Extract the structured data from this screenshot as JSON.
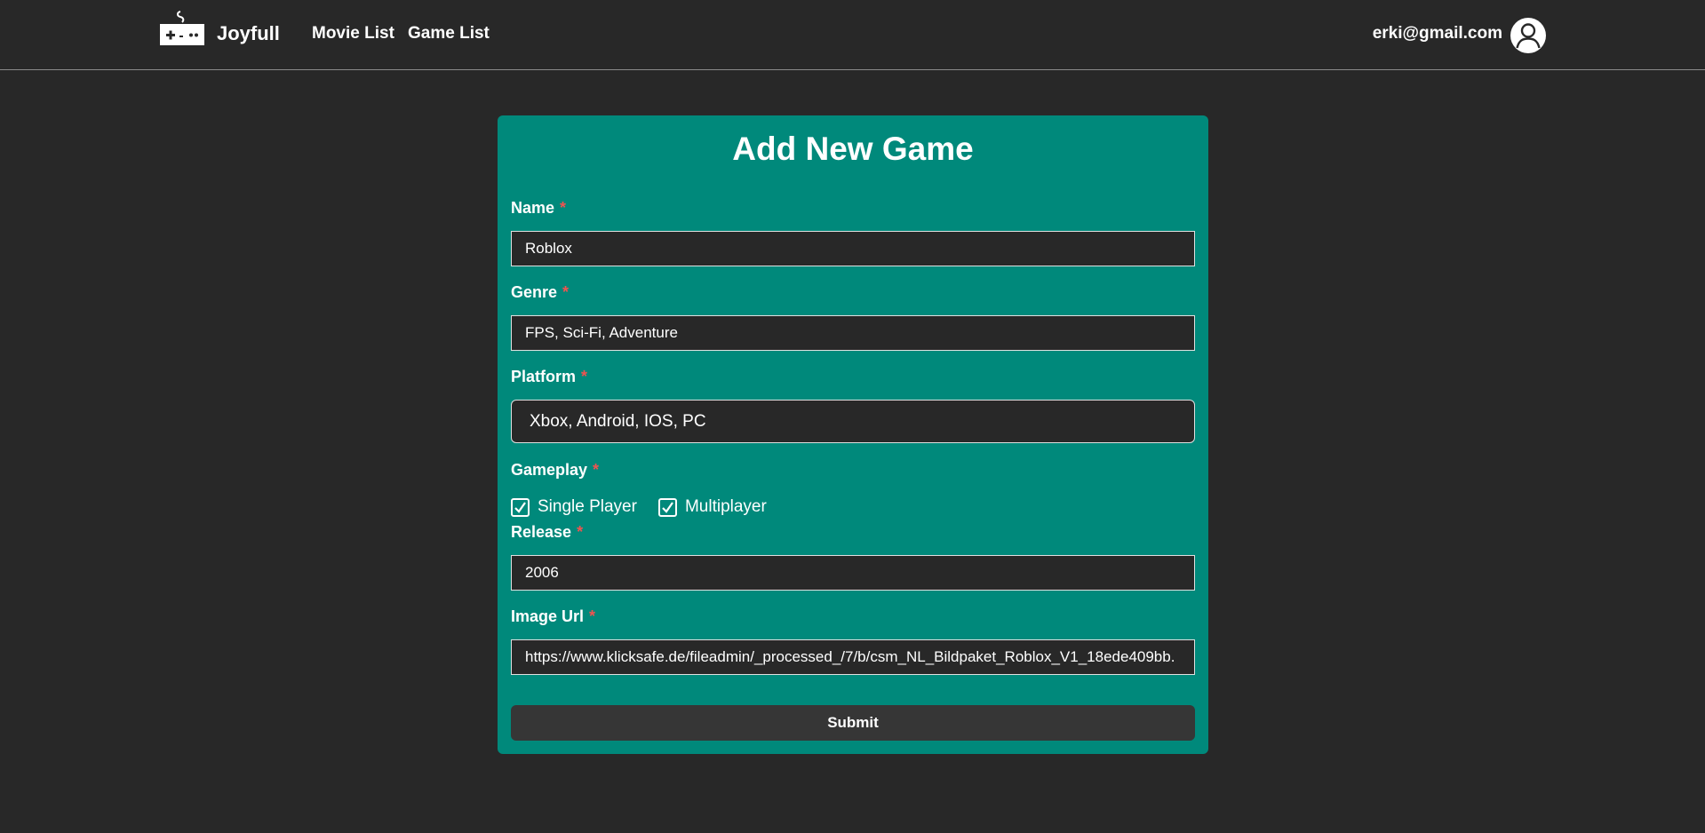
{
  "nav": {
    "brand": "Joyfull",
    "logo_icon": "gamepad-icon",
    "links": [
      "Movie List",
      "Game List"
    ],
    "user_email": "erki@gmail.com",
    "avatar_icon": "user-avatar-icon"
  },
  "form": {
    "title": "Add New Game",
    "required_marker": "*",
    "fields": {
      "name": {
        "label": "Name",
        "value": "Roblox"
      },
      "genre": {
        "label": "Genre",
        "value": "FPS, Sci-Fi, Adventure"
      },
      "platform": {
        "label": "Platform",
        "value": "Xbox, Android, IOS, PC"
      },
      "gameplay": {
        "label": "Gameplay",
        "options": [
          {
            "label": "Single Player",
            "checked": true
          },
          {
            "label": "Multiplayer",
            "checked": true
          }
        ]
      },
      "release": {
        "label": "Release",
        "value": "2006"
      },
      "image_url": {
        "label": "Image Url",
        "value": "https://www.klicksafe.de/fileadmin/_processed_/7/b/csm_NL_Bildpaket_Roblox_V1_18ede409bb."
      }
    },
    "submit_label": "Submit"
  },
  "colors": {
    "background": "#282828",
    "card": "#00897b",
    "required": "#ef5350",
    "button": "#363636"
  }
}
